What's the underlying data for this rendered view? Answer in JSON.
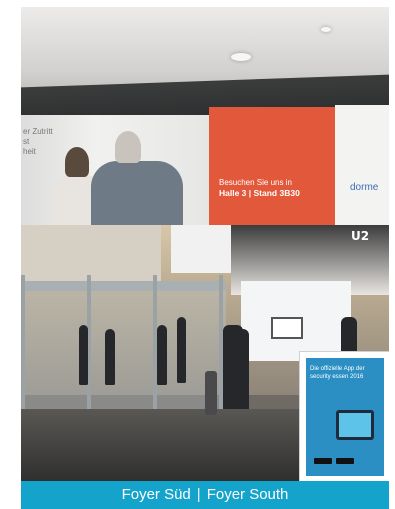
{
  "banner": {
    "left_copy": [
      "er Zutritt",
      "st",
      "heit"
    ],
    "headline_line1": "Besuchen Sie uns in",
    "headline_line2": "Halle 3 | Stand 3B30",
    "brand": "dorme"
  },
  "booth_sign": "U2",
  "poster": {
    "text": "Die offizielle App der security essen 2016"
  },
  "caption": {
    "left": "Foyer Süd",
    "separator": "|",
    "right": "Foyer South"
  },
  "colors": {
    "caption_bg": "#14a3cb",
    "banner_red": "#e2583b",
    "brand_blue": "#3d6fb5"
  }
}
